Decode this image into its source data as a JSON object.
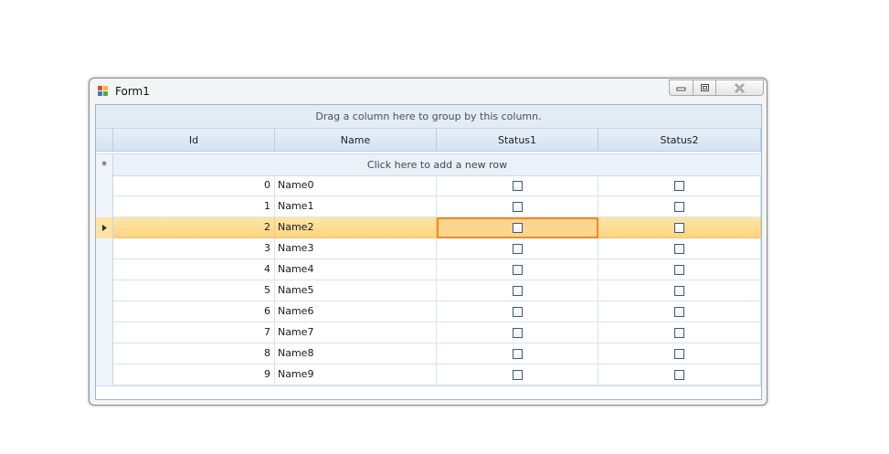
{
  "window": {
    "title": "Form1",
    "icon": "windows-forms-app-icon",
    "controls": [
      "minimize-icon",
      "maximize-icon",
      "close-icon"
    ]
  },
  "grid": {
    "group_panel_text": "Drag a column here to group by this column.",
    "columns": [
      "Id",
      "Name",
      "Status1",
      "Status2"
    ],
    "new_row_text": "Click here to add a new row",
    "new_row_indicator": "*",
    "current_row_indicator": "row-pointer-icon",
    "selected_row_index": 2,
    "focused_column": "Status1",
    "rows": [
      {
        "id": "0",
        "name": "Name0",
        "status1": false,
        "status2": false
      },
      {
        "id": "1",
        "name": "Name1",
        "status1": false,
        "status2": false
      },
      {
        "id": "2",
        "name": "Name2",
        "status1": false,
        "status2": false
      },
      {
        "id": "3",
        "name": "Name3",
        "status1": false,
        "status2": false
      },
      {
        "id": "4",
        "name": "Name4",
        "status1": false,
        "status2": false
      },
      {
        "id": "5",
        "name": "Name5",
        "status1": false,
        "status2": false
      },
      {
        "id": "6",
        "name": "Name6",
        "status1": false,
        "status2": false
      },
      {
        "id": "7",
        "name": "Name7",
        "status1": false,
        "status2": false
      },
      {
        "id": "8",
        "name": "Name8",
        "status1": false,
        "status2": false
      },
      {
        "id": "9",
        "name": "Name9",
        "status1": false,
        "status2": false
      }
    ]
  },
  "colors": {
    "header_bg": "#d4e2f2",
    "grid_line": "#d7e4ef",
    "selected_row": "#fdd27e",
    "focus_border": "#f08a23",
    "checkbox_border": "#3c5a7a"
  }
}
